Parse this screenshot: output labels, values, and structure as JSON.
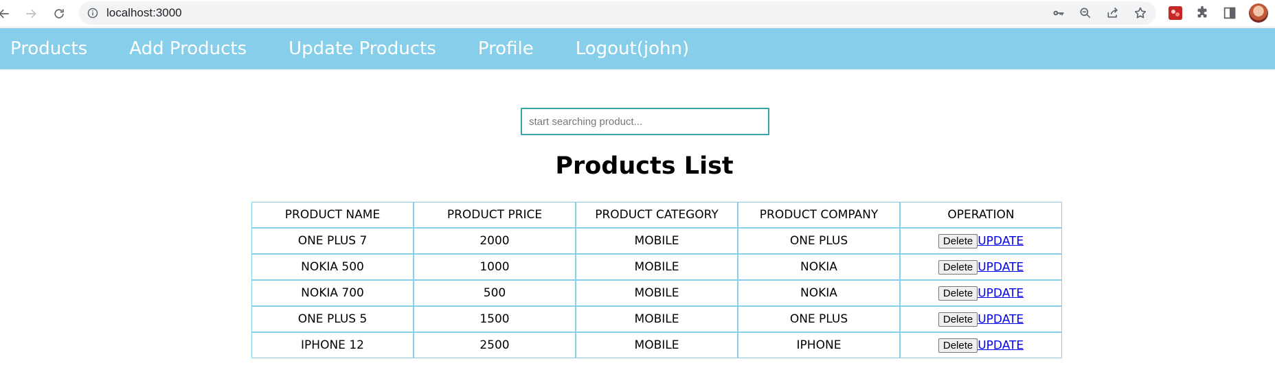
{
  "browser": {
    "url": "localhost:3000"
  },
  "nav": {
    "items": [
      {
        "label": "Products"
      },
      {
        "label": "Add Products"
      },
      {
        "label": "Update Products"
      },
      {
        "label": "Profile"
      },
      {
        "label": "Logout(john)"
      }
    ]
  },
  "search": {
    "placeholder": "start searching product...",
    "value": ""
  },
  "main": {
    "title": "Products List"
  },
  "table": {
    "headers": [
      "PRODUCT NAME",
      "PRODUCT PRICE",
      "PRODUCT CATEGORY",
      "PRODUCT COMPANY",
      "OPERATION"
    ],
    "rows": [
      {
        "name": "ONE PLUS 7",
        "price": "2000",
        "category": "MOBILE",
        "company": "ONE PLUS"
      },
      {
        "name": "NOKIA 500",
        "price": "1000",
        "category": "MOBILE",
        "company": "NOKIA"
      },
      {
        "name": "NOKIA 700",
        "price": "500",
        "category": "MOBILE",
        "company": "NOKIA"
      },
      {
        "name": "ONE PLUS 5",
        "price": "1500",
        "category": "MOBILE",
        "company": "ONE PLUS"
      },
      {
        "name": "IPHONE 12",
        "price": "2500",
        "category": "MOBILE",
        "company": "IPHONE"
      }
    ],
    "delete_label": "Delete",
    "update_label": "UPDATE"
  },
  "colors": {
    "nav_bg": "#87ceeb",
    "table_border": "#87ceeb",
    "search_border": "#3aa3a8",
    "link": "#0000ee"
  },
  "icons": {
    "toolbar": [
      "back-arrow-icon",
      "forward-arrow-icon",
      "reload-icon",
      "info-icon",
      "key-icon",
      "zoom-out-icon",
      "share-icon",
      "star-icon",
      "extension-red-icon",
      "puzzle-icon",
      "side-panel-icon",
      "profile-avatar"
    ]
  }
}
